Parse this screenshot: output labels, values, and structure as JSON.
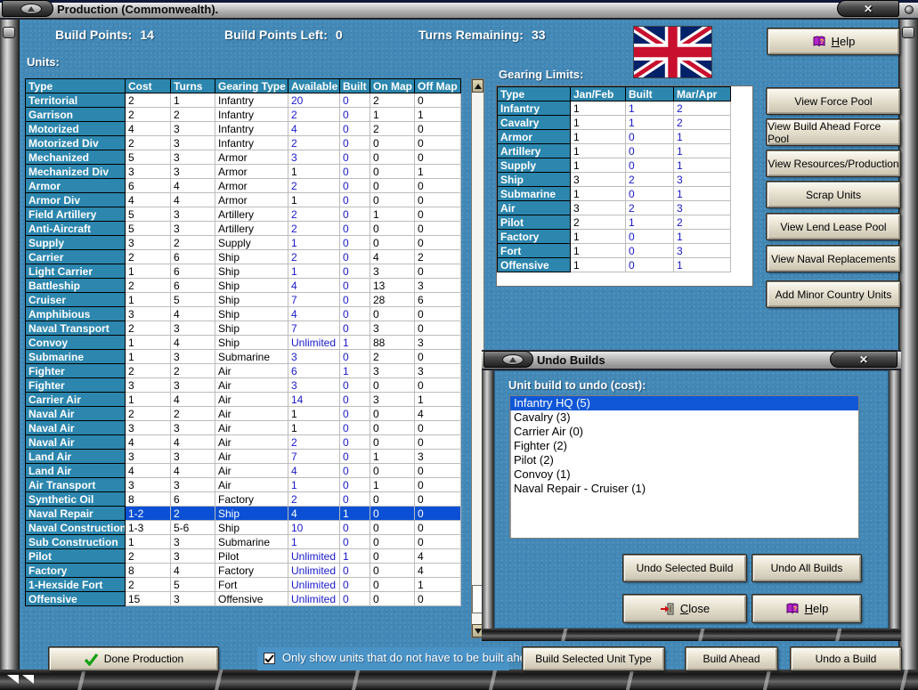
{
  "window": {
    "title": "Production (Commonwealth)."
  },
  "header": {
    "build_points_label": "Build Points:",
    "build_points_value": "14",
    "build_points_left_label": "Build Points Left:",
    "build_points_left_value": "0",
    "turns_remaining_label": "Turns Remaining:",
    "turns_remaining_value": "33"
  },
  "flag": {
    "country": "United Kingdom (Commonwealth)"
  },
  "help_button": {
    "label": "Help"
  },
  "units_table": {
    "section_label": "Units:",
    "columns": [
      "Type",
      "Cost",
      "Turns",
      "Gearing Type",
      "Available",
      "Built",
      "On Map",
      "Off Map"
    ],
    "selected_type": "Naval Repair",
    "rows": [
      {
        "type": "Territorial",
        "cost": "2",
        "turns": "1",
        "gearing": "Infantry",
        "available": "20",
        "built": "0",
        "on_map": "2",
        "off_map": "0",
        "available_color": "blue",
        "selected": false
      },
      {
        "type": "Garrison",
        "cost": "2",
        "turns": "2",
        "gearing": "Infantry",
        "available": "2",
        "built": "0",
        "on_map": "1",
        "off_map": "1",
        "available_color": "blue",
        "selected": false
      },
      {
        "type": "Motorized",
        "cost": "4",
        "turns": "3",
        "gearing": "Infantry",
        "available": "4",
        "built": "0",
        "on_map": "2",
        "off_map": "0",
        "available_color": "blue",
        "selected": false
      },
      {
        "type": "Motorized Div",
        "cost": "2",
        "turns": "3",
        "gearing": "Infantry",
        "available": "2",
        "built": "0",
        "on_map": "0",
        "off_map": "0",
        "available_color": "blue",
        "selected": false
      },
      {
        "type": "Mechanized",
        "cost": "5",
        "turns": "3",
        "gearing": "Armor",
        "available": "3",
        "built": "0",
        "on_map": "0",
        "off_map": "0",
        "available_color": "blue",
        "selected": false
      },
      {
        "type": "Mechanized Div",
        "cost": "3",
        "turns": "3",
        "gearing": "Armor",
        "available": "1",
        "built": "0",
        "on_map": "0",
        "off_map": "1",
        "available_color": "black",
        "selected": false
      },
      {
        "type": "Armor",
        "cost": "6",
        "turns": "4",
        "gearing": "Armor",
        "available": "2",
        "built": "0",
        "on_map": "0",
        "off_map": "0",
        "available_color": "blue",
        "selected": false
      },
      {
        "type": "Armor Div",
        "cost": "4",
        "turns": "4",
        "gearing": "Armor",
        "available": "1",
        "built": "0",
        "on_map": "0",
        "off_map": "0",
        "available_color": "black",
        "selected": false
      },
      {
        "type": "Field Artillery",
        "cost": "5",
        "turns": "3",
        "gearing": "Artillery",
        "available": "2",
        "built": "0",
        "on_map": "1",
        "off_map": "0",
        "available_color": "blue",
        "selected": false
      },
      {
        "type": "Anti-Aircraft",
        "cost": "5",
        "turns": "3",
        "gearing": "Artillery",
        "available": "2",
        "built": "0",
        "on_map": "0",
        "off_map": "0",
        "available_color": "blue",
        "selected": false
      },
      {
        "type": "Supply",
        "cost": "3",
        "turns": "2",
        "gearing": "Supply",
        "available": "1",
        "built": "0",
        "on_map": "0",
        "off_map": "0",
        "available_color": "blue",
        "selected": false
      },
      {
        "type": "Carrier",
        "cost": "2",
        "turns": "6",
        "gearing": "Ship",
        "available": "2",
        "built": "0",
        "on_map": "4",
        "off_map": "2",
        "available_color": "blue",
        "selected": false
      },
      {
        "type": "Light Carrier",
        "cost": "1",
        "turns": "6",
        "gearing": "Ship",
        "available": "1",
        "built": "0",
        "on_map": "3",
        "off_map": "0",
        "available_color": "blue",
        "selected": false
      },
      {
        "type": "Battleship",
        "cost": "2",
        "turns": "6",
        "gearing": "Ship",
        "available": "4",
        "built": "0",
        "on_map": "13",
        "off_map": "3",
        "available_color": "blue",
        "selected": false
      },
      {
        "type": "Cruiser",
        "cost": "1",
        "turns": "5",
        "gearing": "Ship",
        "available": "7",
        "built": "0",
        "on_map": "28",
        "off_map": "6",
        "available_color": "blue",
        "selected": false
      },
      {
        "type": "Amphibious",
        "cost": "3",
        "turns": "4",
        "gearing": "Ship",
        "available": "4",
        "built": "0",
        "on_map": "0",
        "off_map": "0",
        "available_color": "blue",
        "selected": false
      },
      {
        "type": "Naval Transport",
        "cost": "2",
        "turns": "3",
        "gearing": "Ship",
        "available": "7",
        "built": "0",
        "on_map": "3",
        "off_map": "0",
        "available_color": "blue",
        "selected": false
      },
      {
        "type": "Convoy",
        "cost": "1",
        "turns": "4",
        "gearing": "Ship",
        "available": "Unlimited",
        "built": "1",
        "on_map": "88",
        "off_map": "3",
        "available_color": "blue",
        "selected": false
      },
      {
        "type": "Submarine",
        "cost": "1",
        "turns": "3",
        "gearing": "Submarine",
        "available": "3",
        "built": "0",
        "on_map": "2",
        "off_map": "0",
        "available_color": "blue",
        "selected": false
      },
      {
        "type": "Fighter",
        "cost": "2",
        "turns": "2",
        "gearing": "Air",
        "available": "6",
        "built": "1",
        "on_map": "3",
        "off_map": "3",
        "available_color": "blue",
        "selected": false
      },
      {
        "type": "Fighter",
        "cost": "3",
        "turns": "3",
        "gearing": "Air",
        "available": "3",
        "built": "0",
        "on_map": "0",
        "off_map": "0",
        "available_color": "blue",
        "selected": false
      },
      {
        "type": "Carrier Air",
        "cost": "1",
        "turns": "4",
        "gearing": "Air",
        "available": "14",
        "built": "0",
        "on_map": "3",
        "off_map": "1",
        "available_color": "blue",
        "selected": false
      },
      {
        "type": "Naval Air",
        "cost": "2",
        "turns": "2",
        "gearing": "Air",
        "available": "1",
        "built": "0",
        "on_map": "0",
        "off_map": "4",
        "available_color": "black",
        "selected": false
      },
      {
        "type": "Naval Air",
        "cost": "3",
        "turns": "3",
        "gearing": "Air",
        "available": "1",
        "built": "0",
        "on_map": "0",
        "off_map": "0",
        "available_color": "black",
        "selected": false
      },
      {
        "type": "Naval Air",
        "cost": "4",
        "turns": "4",
        "gearing": "Air",
        "available": "2",
        "built": "0",
        "on_map": "0",
        "off_map": "0",
        "available_color": "blue",
        "selected": false
      },
      {
        "type": "Land Air",
        "cost": "3",
        "turns": "3",
        "gearing": "Air",
        "available": "7",
        "built": "0",
        "on_map": "1",
        "off_map": "3",
        "available_color": "blue",
        "selected": false
      },
      {
        "type": "Land Air",
        "cost": "4",
        "turns": "4",
        "gearing": "Air",
        "available": "4",
        "built": "0",
        "on_map": "0",
        "off_map": "0",
        "available_color": "blue",
        "selected": false
      },
      {
        "type": "Air Transport",
        "cost": "3",
        "turns": "3",
        "gearing": "Air",
        "available": "1",
        "built": "0",
        "on_map": "1",
        "off_map": "0",
        "available_color": "blue",
        "selected": false
      },
      {
        "type": "Synthetic Oil",
        "cost": "8",
        "turns": "6",
        "gearing": "Factory",
        "available": "2",
        "built": "0",
        "on_map": "0",
        "off_map": "0",
        "available_color": "blue",
        "selected": false
      },
      {
        "type": "Naval Repair",
        "cost": "1-2",
        "turns": "2",
        "gearing": "Ship",
        "available": "4",
        "built": "1",
        "on_map": "0",
        "off_map": "0",
        "available_color": "blue",
        "selected": true
      },
      {
        "type": "Naval Construction",
        "cost": "1-3",
        "turns": "5-6",
        "gearing": "Ship",
        "available": "10",
        "built": "0",
        "on_map": "0",
        "off_map": "0",
        "available_color": "blue",
        "selected": false
      },
      {
        "type": "Sub Construction",
        "cost": "1",
        "turns": "3",
        "gearing": "Submarine",
        "available": "1",
        "built": "0",
        "on_map": "0",
        "off_map": "0",
        "available_color": "blue",
        "selected": false
      },
      {
        "type": "Pilot",
        "cost": "2",
        "turns": "3",
        "gearing": "Pilot",
        "available": "Unlimited",
        "built": "1",
        "on_map": "0",
        "off_map": "4",
        "available_color": "blue",
        "selected": false
      },
      {
        "type": "Factory",
        "cost": "8",
        "turns": "4",
        "gearing": "Factory",
        "available": "Unlimited",
        "built": "0",
        "on_map": "0",
        "off_map": "4",
        "available_color": "blue",
        "selected": false
      },
      {
        "type": "1-Hexside Fort",
        "cost": "2",
        "turns": "5",
        "gearing": "Fort",
        "available": "Unlimited",
        "built": "0",
        "on_map": "0",
        "off_map": "1",
        "available_color": "blue",
        "selected": false
      },
      {
        "type": "Offensive",
        "cost": "15",
        "turns": "3",
        "gearing": "Offensive",
        "available": "Unlimited",
        "built": "0",
        "on_map": "0",
        "off_map": "0",
        "available_color": "blue",
        "selected": false
      }
    ]
  },
  "gearing_table": {
    "section_label": "Gearing Limits:",
    "columns": [
      "Type",
      "Jan/Feb",
      "Built",
      "Mar/Apr"
    ],
    "rows": [
      {
        "type": "Infantry",
        "jan_feb": "1",
        "built": "1",
        "mar_apr": "2"
      },
      {
        "type": "Cavalry",
        "jan_feb": "1",
        "built": "1",
        "mar_apr": "2"
      },
      {
        "type": "Armor",
        "jan_feb": "1",
        "built": "0",
        "mar_apr": "1"
      },
      {
        "type": "Artillery",
        "jan_feb": "1",
        "built": "0",
        "mar_apr": "1"
      },
      {
        "type": "Supply",
        "jan_feb": "1",
        "built": "0",
        "mar_apr": "1"
      },
      {
        "type": "Ship",
        "jan_feb": "3",
        "built": "2",
        "mar_apr": "3"
      },
      {
        "type": "Submarine",
        "jan_feb": "1",
        "built": "0",
        "mar_apr": "1"
      },
      {
        "type": "Air",
        "jan_feb": "3",
        "built": "2",
        "mar_apr": "3"
      },
      {
        "type": "Pilot",
        "jan_feb": "2",
        "built": "1",
        "mar_apr": "2"
      },
      {
        "type": "Factory",
        "jan_feb": "1",
        "built": "0",
        "mar_apr": "1"
      },
      {
        "type": "Fort",
        "jan_feb": "1",
        "built": "0",
        "mar_apr": "3"
      },
      {
        "type": "Offensive",
        "jan_feb": "1",
        "built": "0",
        "mar_apr": "1"
      }
    ]
  },
  "side_buttons": [
    "View Force Pool",
    "View Build Ahead Force Pool",
    "View Resources/Production",
    "Scrap Units",
    "View Lend Lease Pool",
    "View Naval Replacements",
    "Add Minor Country Units"
  ],
  "undo_window": {
    "title": "Undo Builds",
    "list_label": "Unit build to undo (cost):",
    "items": [
      "Infantry HQ (5)",
      "Cavalry (3)",
      "Carrier Air (0)",
      "Fighter (2)",
      "Pilot (2)",
      "Convoy (1)",
      "Naval Repair - Cruiser (1)"
    ],
    "selected_index": 0,
    "undo_selected_label": "Undo Selected Build",
    "undo_all_label": "Undo All Builds",
    "close_label": "Close",
    "help_label": "Help"
  },
  "footer": {
    "done_label": "Done Production",
    "checkbox_checked": true,
    "checkbox_label": "Only show units that do not have to be built ahead.",
    "build_selected_label": "Build Selected Unit Type",
    "build_ahead_label": "Build Ahead",
    "undo_build_label": "Undo a Build"
  },
  "colors": {
    "bgblue": "#4288b6",
    "teal": "#2c86ad",
    "selblue": "#0b50d4",
    "valblue": "#1818cc",
    "listsel": "#1057d8",
    "strip": "#4a93c6"
  }
}
